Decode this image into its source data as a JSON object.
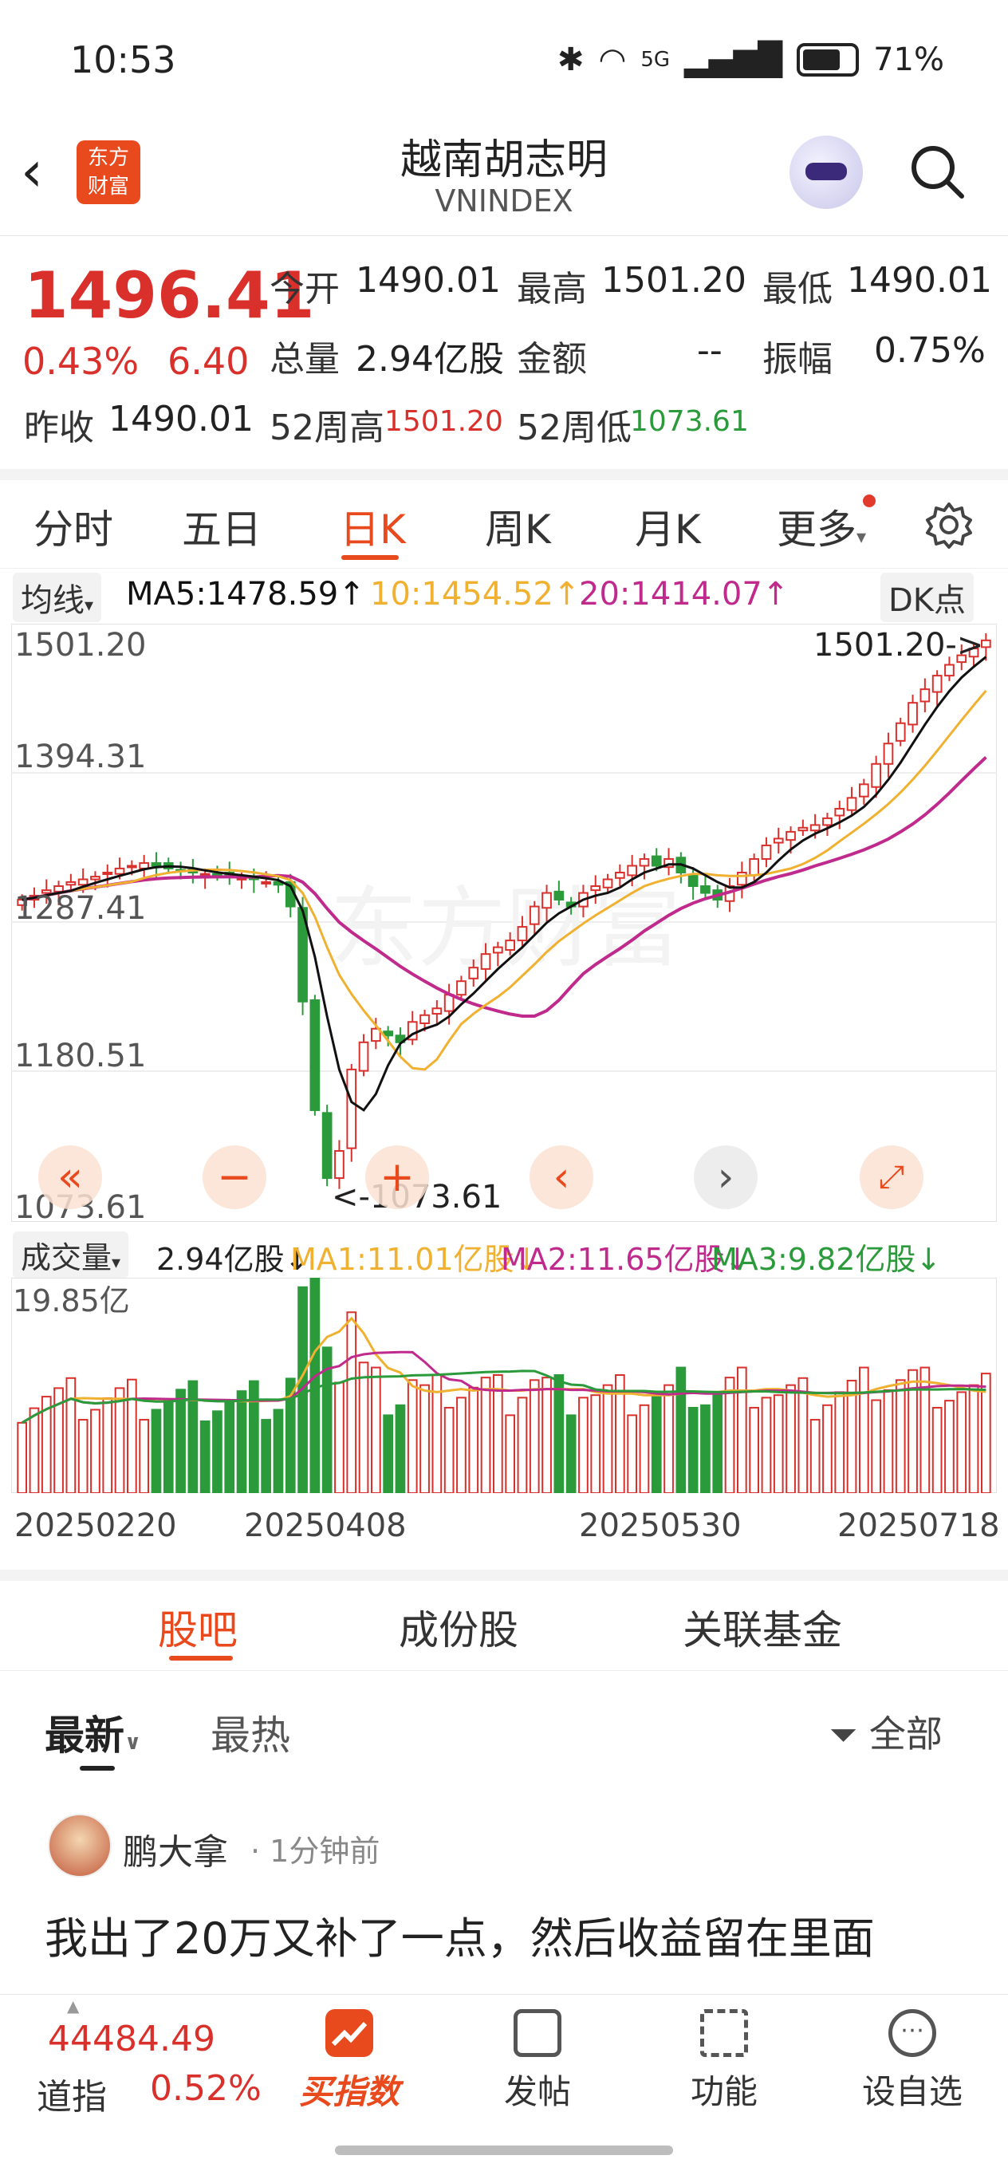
{
  "status": {
    "time": "10:53",
    "network": "5G",
    "battery": "71%"
  },
  "header": {
    "logo_line1": "东方",
    "logo_line2": "财富",
    "title": "越南胡志明",
    "subtitle": "VNINDEX"
  },
  "quote": {
    "price": "1496.41",
    "pct": "0.43%",
    "change": "6.40",
    "open_label": "今开",
    "open": "1490.01",
    "high_label": "最高",
    "high": "1501.20",
    "low_label": "最低",
    "low": "1490.01",
    "vol_label": "总量",
    "vol": "2.94亿股",
    "amount_label": "金额",
    "amount": "--",
    "amp_label": "振幅",
    "amp": "0.75%",
    "prev_label": "昨收",
    "prev": "1490.01",
    "w52h_label": "52周高",
    "w52h": "1501.20",
    "w52l_label": "52周低",
    "w52l": "1073.61"
  },
  "tabs": [
    "分时",
    "五日",
    "日K",
    "周K",
    "月K",
    "更多"
  ],
  "ma": {
    "dropdown": "均线",
    "ma5": "MA5:1478.59↑",
    "ma10": "10:1454.52↑",
    "ma20": "20:1414.07↑",
    "dk": "DK点"
  },
  "chart_labels": {
    "y1": "1501.20",
    "y2": "1394.31",
    "y3": "1287.41",
    "y4": "1180.51",
    "y5": "1073.61",
    "max_note": "1501.20->",
    "min_note": "<-1073.61",
    "watermark": "东方财富"
  },
  "volume": {
    "dropdown": "成交量",
    "value": "2.94亿股↓",
    "ma1": "MA1:11.01亿股↓",
    "ma2": "MA2:11.65亿股↓",
    "ma3": "MA3:9.82亿股↓",
    "ymax": "19.85亿"
  },
  "dates": [
    "20250220",
    "20250408",
    "20250530",
    "20250718"
  ],
  "subtabs": [
    "股吧",
    "成份股",
    "关联基金"
  ],
  "filters": {
    "latest": "最新",
    "hot": "最热",
    "all": "全部"
  },
  "post": {
    "user": "鹏大拿",
    "time": "· 1分钟前",
    "text": "我出了20万又补了一点，然后收益留在里面"
  },
  "bottom": {
    "dow_value": "44484.49",
    "dow_label": "道指",
    "dow_pct": "0.52%",
    "buy": "买指数",
    "post": "发帖",
    "func": "功能",
    "watch": "设自选"
  },
  "colors": {
    "up": "#d9302c",
    "down": "#2a9a3a",
    "accent": "#e8491d",
    "ma5": "#111111",
    "ma10": "#f0b030",
    "ma20": "#c02a8c"
  },
  "chart_data": {
    "type": "candlestick",
    "ylim": [
      1073.61,
      1501.2
    ],
    "y_ticks": [
      1501.2,
      1394.31,
      1287.41,
      1180.51,
      1073.61
    ],
    "x_ticks": [
      "20250220",
      "20250408",
      "20250530",
      "20250718"
    ],
    "closes": [
      1305,
      1308,
      1312,
      1315,
      1318,
      1320,
      1322,
      1325,
      1328,
      1330,
      1332,
      1330,
      1328,
      1326,
      1325,
      1324,
      1323,
      1322,
      1321,
      1320,
      1318,
      1316,
      1300,
      1230,
      1150,
      1100,
      1120,
      1180,
      1200,
      1210,
      1205,
      1200,
      1215,
      1220,
      1225,
      1235,
      1245,
      1255,
      1265,
      1270,
      1275,
      1285,
      1300,
      1310,
      1305,
      1300,
      1310,
      1315,
      1320,
      1325,
      1330,
      1335,
      1330,
      1335,
      1325,
      1315,
      1310,
      1305,
      1315,
      1325,
      1335,
      1345,
      1350,
      1355,
      1358,
      1360,
      1365,
      1372,
      1380,
      1390,
      1405,
      1420,
      1435,
      1450,
      1460,
      1470,
      1478,
      1485,
      1490,
      1496
    ]
  }
}
